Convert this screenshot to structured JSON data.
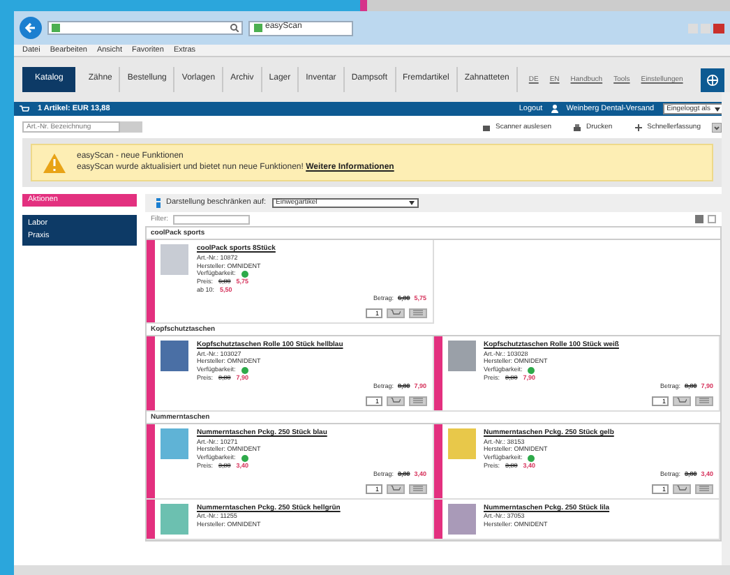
{
  "browser": {
    "tab_title": "easyScan",
    "menu": [
      "Datei",
      "Bearbeiten",
      "Ansicht",
      "Favoriten",
      "Extras"
    ]
  },
  "nav": {
    "tabs": [
      {
        "label": "Katalog",
        "selected": true
      },
      {
        "label": "Zähne",
        "selected": false
      },
      {
        "label": "Bestellung",
        "selected": false
      },
      {
        "label": "Vorlagen",
        "selected": false
      },
      {
        "label": "Archiv",
        "selected": false
      },
      {
        "label": "Lager",
        "selected": false
      },
      {
        "label": "Inventar",
        "selected": false
      },
      {
        "label": "Dampsoft",
        "selected": false
      },
      {
        "label": "Fremdartikel",
        "selected": false
      },
      {
        "label": "Zahnatteten",
        "selected": false
      }
    ],
    "links": [
      "DE",
      "EN",
      "Handbuch",
      "Tools",
      "Einstellungen"
    ]
  },
  "cart_bar": {
    "summary": "1 Artikel: EUR 13,88",
    "logout": "Logout",
    "user": "Weinberg Dental-Versand",
    "login_select": "Eingeloggt als"
  },
  "toolbar": {
    "search_placeholder": "Art.-Nr. Bezeichnung",
    "actions": [
      "Scanner auslesen",
      "Drucken",
      "Schnellerfassung"
    ]
  },
  "notice": {
    "title": "easyScan - neue Funktionen",
    "text": "easyScan wurde aktualisiert und bietet nun neue Funktionen!",
    "link": "Weitere Informationen"
  },
  "sidebar": {
    "items": [
      {
        "label": "Aktionen",
        "kind": "promo"
      },
      {
        "label": "Labor",
        "kind": "category"
      },
      {
        "label": "Praxis",
        "kind": "category"
      }
    ]
  },
  "filter": {
    "label": "Darstellung beschränken auf:",
    "value": "Einwegartikel",
    "filter_label": "Filter:"
  },
  "groups": [
    {
      "title": "coolPack sports",
      "products": [
        {
          "title": "coolPack sports 8Stück",
          "art_nr": "Art.-Nr.: 10872",
          "manufacturer": "Hersteller: OMNIDENT",
          "availability": "Verfügbarkeit:",
          "available": true,
          "price_label": "Preis:",
          "price_old": "6,80",
          "price_new": "5,75",
          "bulk": "ab 10:",
          "bulk_price": "5,50",
          "amount_label": "Betrag:",
          "amount_old": "6,80",
          "amount_new": "5,75",
          "quantity": "1",
          "color": "#c8ccd4"
        }
      ]
    },
    {
      "title": "Kopfschutztaschen",
      "products": [
        {
          "title": "Kopfschutztaschen Rolle 100 Stück hellblau",
          "art_nr": "Art.-Nr.: 103027",
          "manufacturer": "Hersteller: OMNIDENT",
          "availability": "Verfügbarkeit:",
          "available": true,
          "price_label": "Preis:",
          "price_old": "8,80",
          "price_new": "7,90",
          "amount_label": "Betrag:",
          "amount_old": "8,80",
          "amount_new": "7,90",
          "quantity": "1",
          "color": "#4a6fa5"
        },
        {
          "title": "Kopfschutztaschen Rolle 100 Stück weiß",
          "art_nr": "Art.-Nr.: 103028",
          "manufacturer": "Hersteller: OMNIDENT",
          "availability": "Verfügbarkeit:",
          "available": true,
          "price_label": "Preis:",
          "price_old": "8,80",
          "price_new": "7,90",
          "amount_label": "Betrag:",
          "amount_old": "8,80",
          "amount_new": "7,90",
          "quantity": "1",
          "color": "#9aa0a8"
        }
      ]
    },
    {
      "title": "Nummerntaschen",
      "products": [
        {
          "title": "Nummerntaschen Pckg. 250 Stück blau",
          "art_nr": "Art.-Nr.: 10271",
          "manufacturer": "Hersteller: OMNIDENT",
          "availability": "Verfügbarkeit:",
          "available": true,
          "price_label": "Preis:",
          "price_old": "3,80",
          "price_new": "3,40",
          "amount_label": "Betrag:",
          "amount_old": "3,80",
          "amount_new": "3,40",
          "quantity": "1",
          "color": "#5fb3d6"
        },
        {
          "title": "Nummerntaschen Pckg. 250 Stück gelb",
          "art_nr": "Art.-Nr.: 38153",
          "manufacturer": "Hersteller: OMNIDENT",
          "availability": "Verfügbarkeit:",
          "available": true,
          "price_label": "Preis:",
          "price_old": "3,80",
          "price_new": "3,40",
          "amount_label": "Betrag:",
          "amount_old": "3,80",
          "amount_new": "3,40",
          "quantity": "1",
          "color": "#e8c84a"
        },
        {
          "title": "Nummerntaschen Pckg. 250 Stück hellgrün",
          "art_nr": "Art.-Nr.: 11255",
          "manufacturer": "Hersteller: OMNIDENT",
          "color": "#6cc0b0"
        },
        {
          "title": "Nummerntaschen Pckg. 250 Stück lila",
          "art_nr": "Art.-Nr.: 37053",
          "manufacturer": "Hersteller: OMNIDENT",
          "color": "#a99ab8"
        }
      ]
    }
  ]
}
